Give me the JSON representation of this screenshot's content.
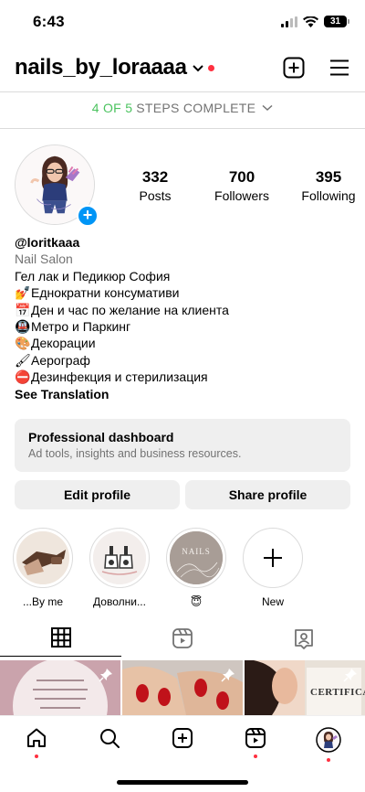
{
  "status_bar": {
    "time": "6:43",
    "battery": "31"
  },
  "header": {
    "username": "nails_by_loraaaa"
  },
  "steps": {
    "done": "4 OF 5",
    "rest": "STEPS COMPLETE"
  },
  "stats": [
    {
      "num": "332",
      "label": "Posts"
    },
    {
      "num": "700",
      "label": "Followers"
    },
    {
      "num": "395",
      "label": "Following"
    }
  ],
  "bio": {
    "handle": "@loritkaaa",
    "category": "Nail Salon",
    "lines": [
      {
        "emoji": "",
        "text": "Гел лак и Педикюр София"
      },
      {
        "emoji": "💅",
        "text": "Еднократни консумативи"
      },
      {
        "emoji": "📅",
        "text": "Ден и час по желание на клиента"
      },
      {
        "emoji": "🚇",
        "text": "Метро и Паркинг"
      },
      {
        "emoji": "🎨",
        "text": "Декорации"
      },
      {
        "emoji": "🖌",
        "text": "Аерограф"
      },
      {
        "emoji": "⛔",
        "text": "Дезинфекция и стерилизация"
      }
    ],
    "see_translation": "See Translation"
  },
  "dashboard": {
    "title": "Professional dashboard",
    "subtitle": "Ad tools, insights and business resources."
  },
  "buttons": {
    "edit": "Edit profile",
    "share": "Share profile"
  },
  "highlights": [
    {
      "label": "...By me"
    },
    {
      "label": "Доволни..."
    },
    {
      "label": "😇"
    },
    {
      "label": "New"
    }
  ],
  "highlight_art": {
    "nails_text": "NAILS"
  },
  "grid_art": {
    "certificate_text": "CERTIFICA"
  },
  "colors": {
    "accent_blue": "#0095f6",
    "notification_red": "#ff3040",
    "steps_green": "#4bc35f"
  },
  "icons": [
    "wifi-icon",
    "cellular-icon",
    "new-post-icon",
    "menu-icon",
    "grid-icon",
    "reels-icon",
    "tagged-icon",
    "home-icon",
    "search-icon",
    "create-icon",
    "reels-nav-icon",
    "profile-avatar-icon"
  ]
}
